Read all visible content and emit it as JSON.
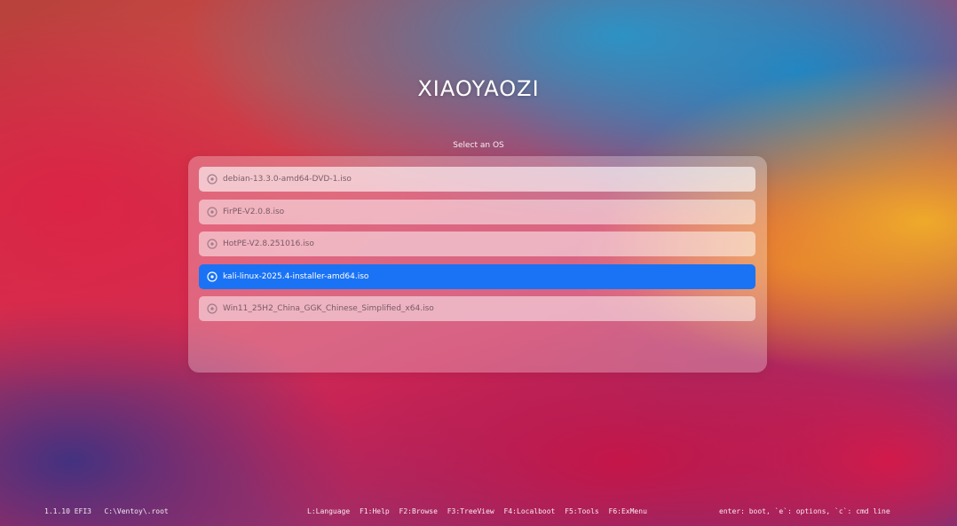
{
  "header": {
    "title": "XIAOYAOZI",
    "subtitle": "Select an OS"
  },
  "os_list": {
    "items": [
      {
        "label": "debian-13.3.0-amd64-DVD-1.iso",
        "icon": "disc-icon",
        "selected": false
      },
      {
        "label": "FirPE-V2.0.8.iso",
        "icon": "disc-icon",
        "selected": false
      },
      {
        "label": "HotPE-V2.8.251016.iso",
        "icon": "disc-icon",
        "selected": false
      },
      {
        "label": "kali-linux-2025.4-installer-amd64.iso",
        "icon": "disc-icon",
        "selected": true
      },
      {
        "label": "Win11_25H2_China_GGK_Chinese_Simplified_x64.iso",
        "icon": "disc-icon",
        "selected": false
      }
    ]
  },
  "footer": {
    "version": "1.1.10 EFI3",
    "path": "C:\\Ventoy\\.root",
    "hotkeys": [
      {
        "label": "L:Language"
      },
      {
        "label": "F1:Help"
      },
      {
        "label": "F2:Browse"
      },
      {
        "label": "F3:TreeView"
      },
      {
        "label": "F4:Localboot"
      },
      {
        "label": "F5:Tools"
      },
      {
        "label": "F6:ExMenu"
      }
    ],
    "hint": "enter: boot, `e`: options, `c`: cmd line"
  },
  "colors": {
    "selection": "#1a73f5",
    "panel": "rgba(255,255,255,0.28)",
    "text_light": "#ffffff"
  }
}
